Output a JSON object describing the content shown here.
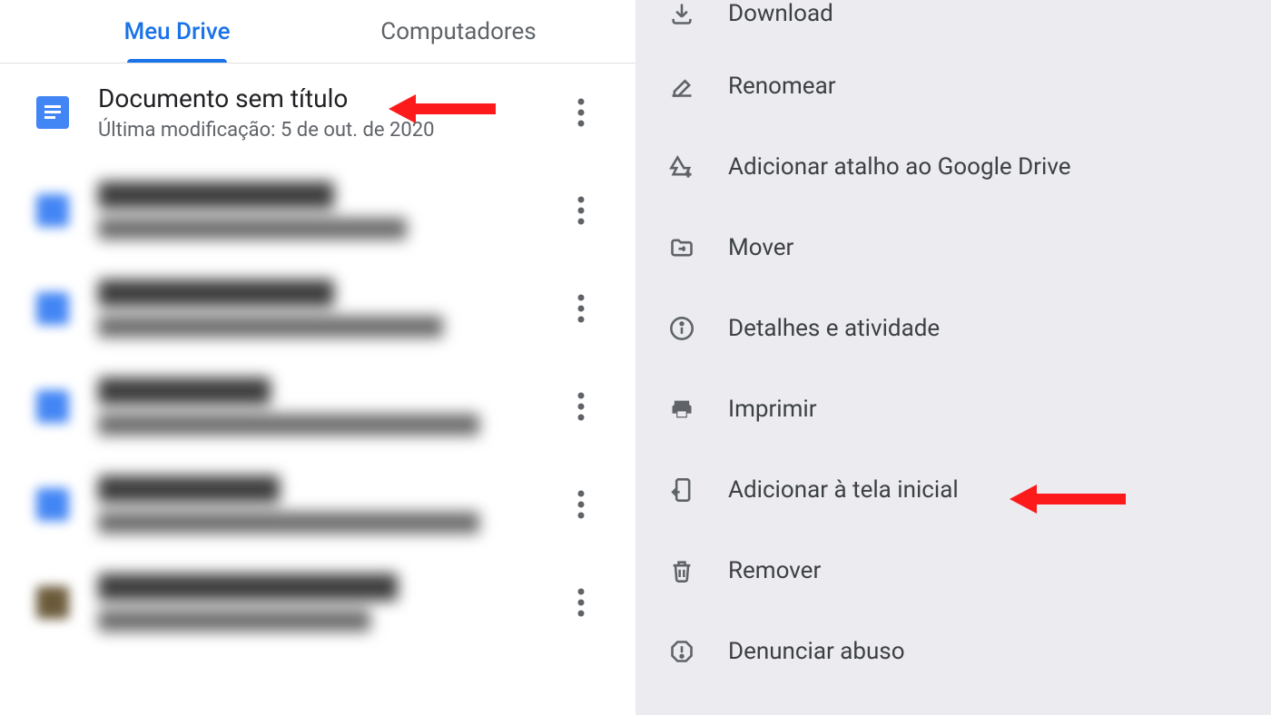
{
  "tabs": {
    "drive": "Meu Drive",
    "computers": "Computadores"
  },
  "file": {
    "title": "Documento sem título",
    "subtitle": "Última modificação: 5 de out. de 2020"
  },
  "menu": {
    "download": "Download",
    "rename": "Renomear",
    "add_shortcut": "Adicionar atalho ao Google Drive",
    "move": "Mover",
    "details": "Detalhes e atividade",
    "print": "Imprimir",
    "add_home": "Adicionar à tela inicial",
    "remove": "Remover",
    "report": "Denunciar abuso"
  },
  "colors": {
    "accent": "#1a73e8",
    "doc_blue": "#4285f4",
    "text_primary": "#202124",
    "text_secondary": "#5f6368",
    "menu_bg": "#ebebf0",
    "arrow_red": "#fd1a1a"
  }
}
